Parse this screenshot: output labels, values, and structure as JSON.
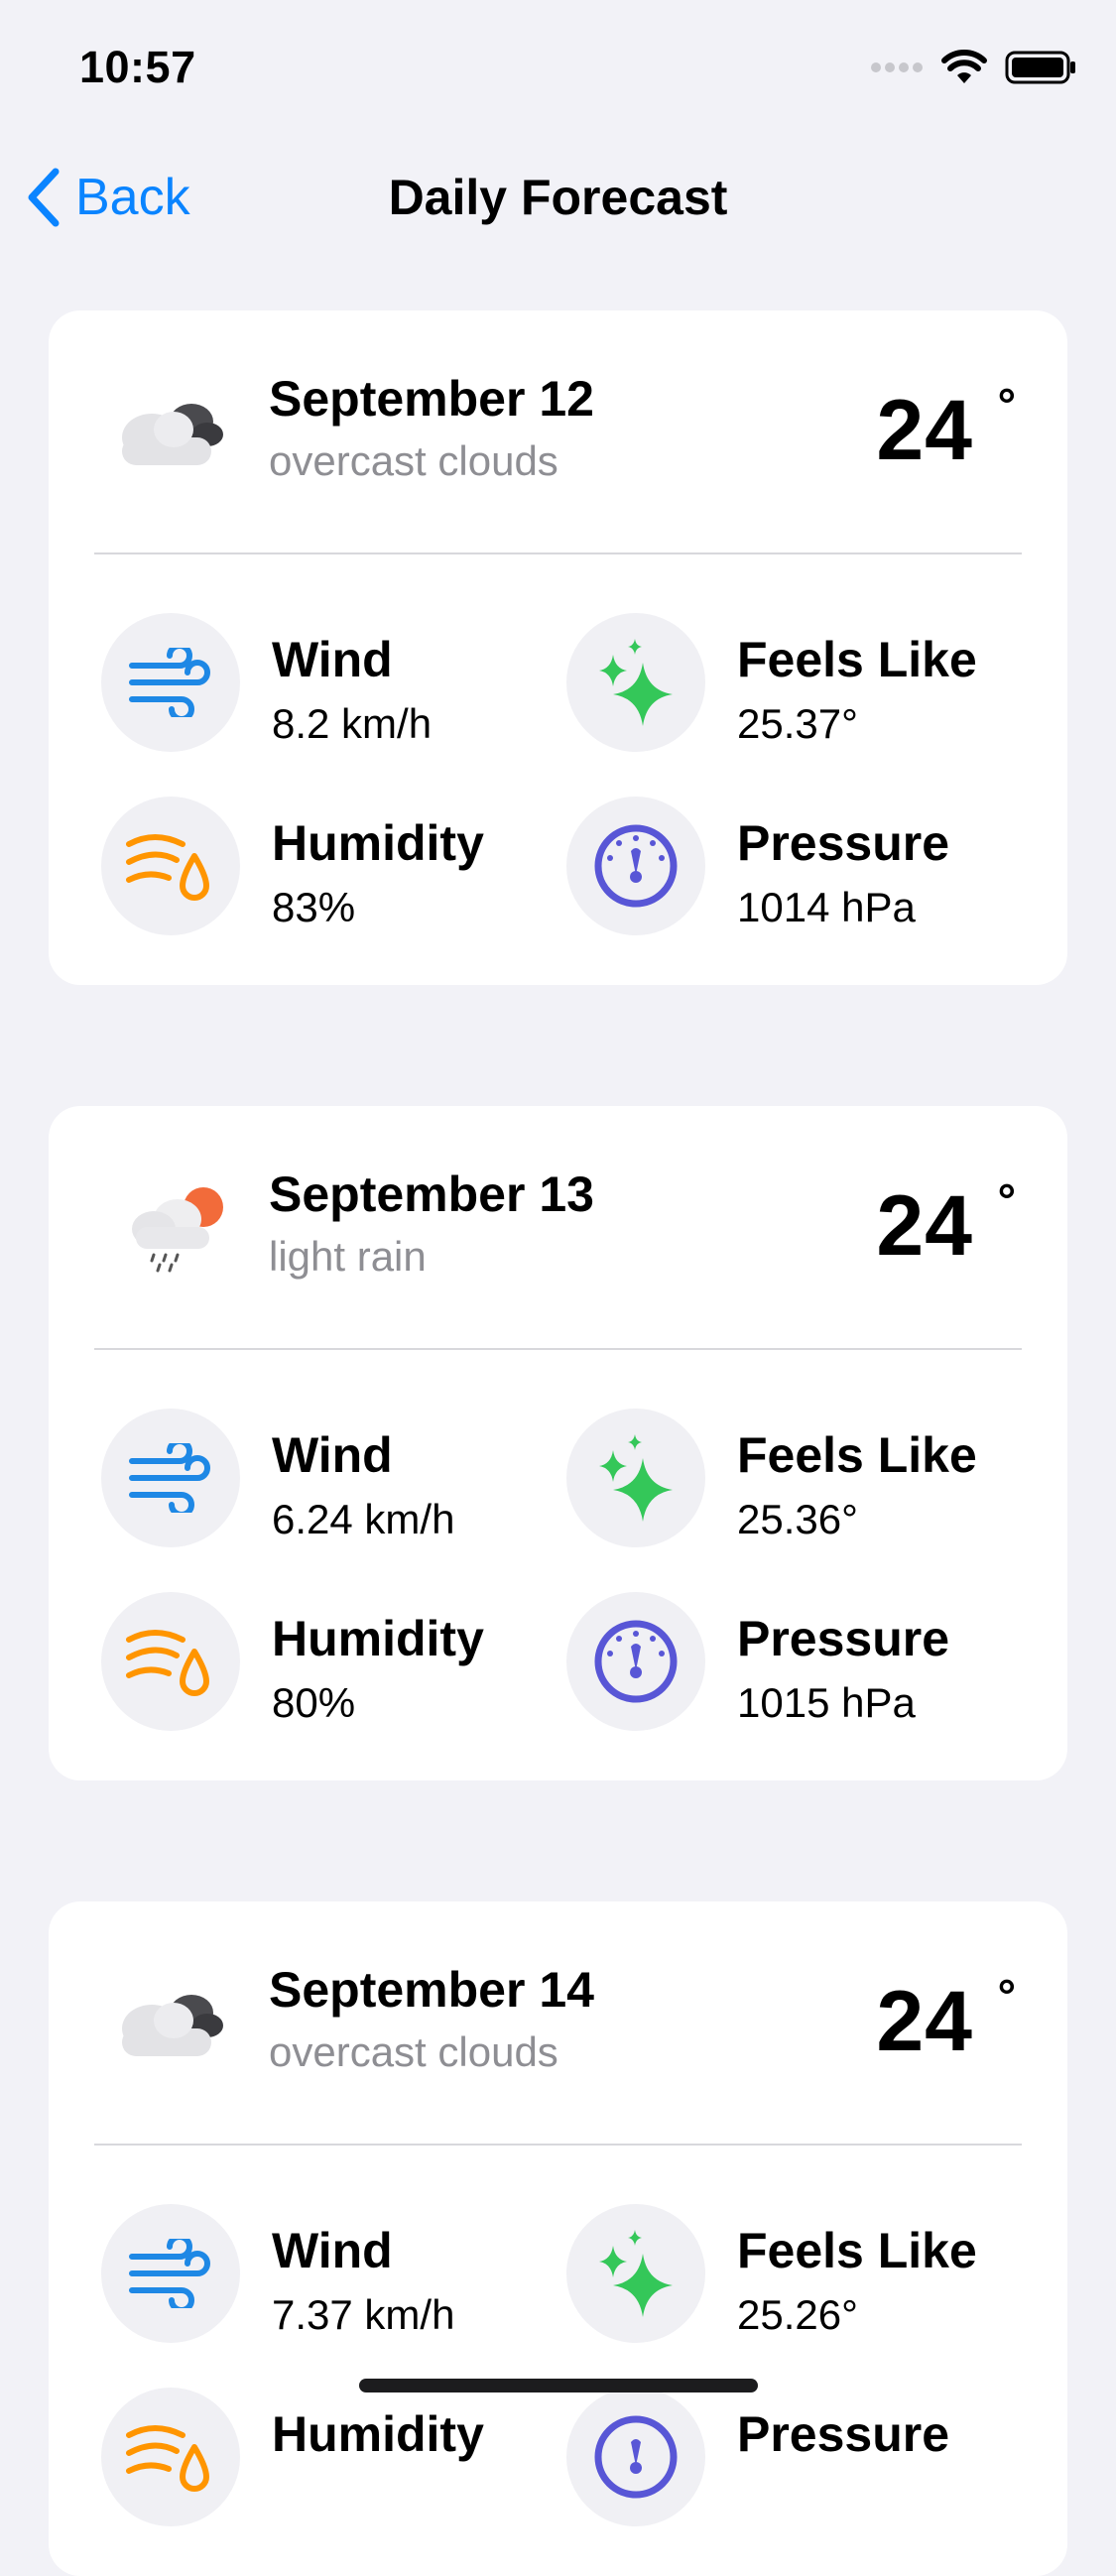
{
  "status": {
    "time": "10:57"
  },
  "nav": {
    "back_label": "Back",
    "title": "Daily Forecast"
  },
  "days": [
    {
      "date": "September 12",
      "description": "overcast clouds",
      "temp": "24",
      "deg": "°",
      "icon": "overcast-clouds-icon",
      "wind_label": "Wind",
      "wind": "8.2 km/h",
      "feels_label": "Feels Like",
      "feels": "25.37°",
      "humidity_label": "Humidity",
      "humidity": "83%",
      "pressure_label": "Pressure",
      "pressure": "1014 hPa"
    },
    {
      "date": "September 13",
      "description": "light rain",
      "temp": "24",
      "deg": "°",
      "icon": "light-rain-icon",
      "wind_label": "Wind",
      "wind": "6.24 km/h",
      "feels_label": "Feels Like",
      "feels": "25.36°",
      "humidity_label": "Humidity",
      "humidity": "80%",
      "pressure_label": "Pressure",
      "pressure": "1015 hPa"
    },
    {
      "date": "September 14",
      "description": "overcast clouds",
      "temp": "24",
      "deg": "°",
      "icon": "overcast-clouds-icon",
      "wind_label": "Wind",
      "wind": "7.37 km/h",
      "feels_label": "Feels Like",
      "feels": "25.26°",
      "humidity_label": "Humidity",
      "humidity": "",
      "pressure_label": "Pressure",
      "pressure": ""
    }
  ],
  "colors": {
    "accent": "#0a84ff",
    "wind": "#1e88e5",
    "feels": "#34c759",
    "humidity": "#ff9500",
    "pressure": "#5856d6",
    "secondary_text": "#8e8e93"
  }
}
